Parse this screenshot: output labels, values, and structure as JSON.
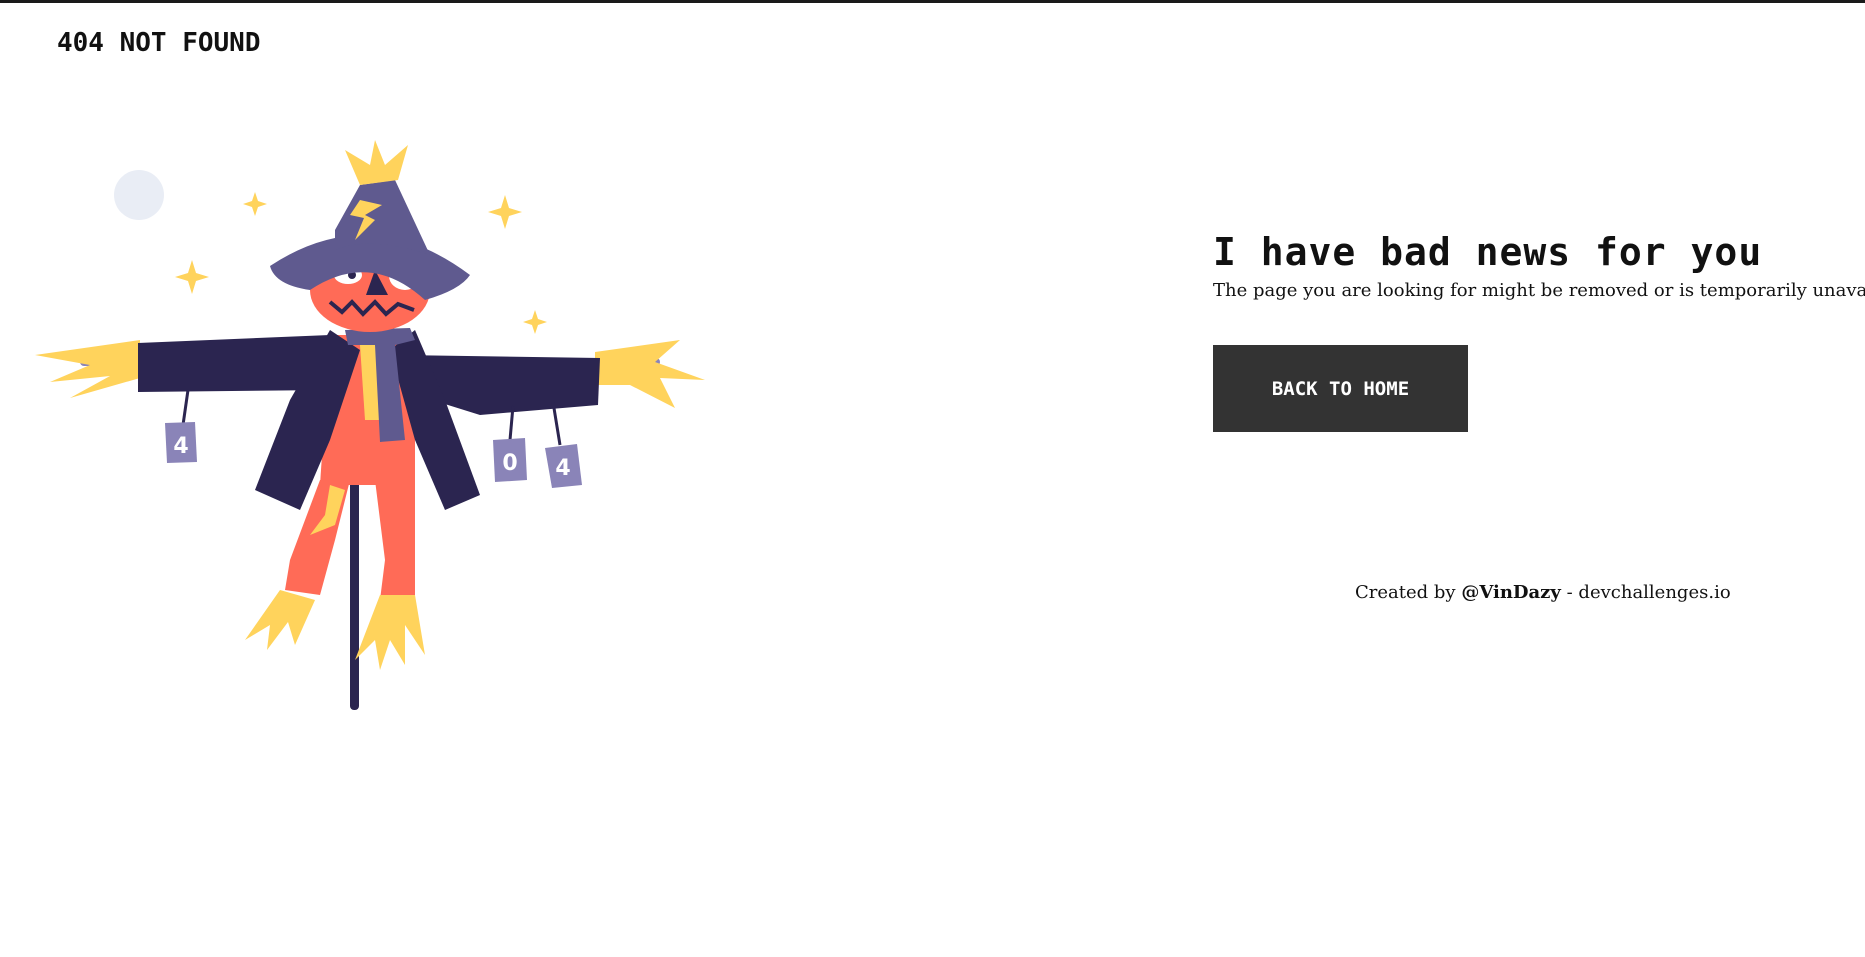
{
  "header": {
    "logo_text": "404 NOT FOUND"
  },
  "main": {
    "headline": "I have bad news for you",
    "subtext": "The page you are looking for might be removed or is temporarily unavailable",
    "home_button_label": "BACK TO HOME"
  },
  "footer": {
    "prefix": "Created by",
    "author": "@VinDazy",
    "separator": "-",
    "site": "devchallenges.io"
  },
  "illustration": {
    "can_labels": [
      "4",
      "0",
      "4"
    ]
  },
  "colors": {
    "button_bg": "#333333",
    "scarecrow_coat": "#2b2550",
    "scarecrow_hat": "#5f5a8f",
    "scarecrow_face": "#ff6b57",
    "straw": "#ffd35c",
    "can": "#8a84b8"
  }
}
